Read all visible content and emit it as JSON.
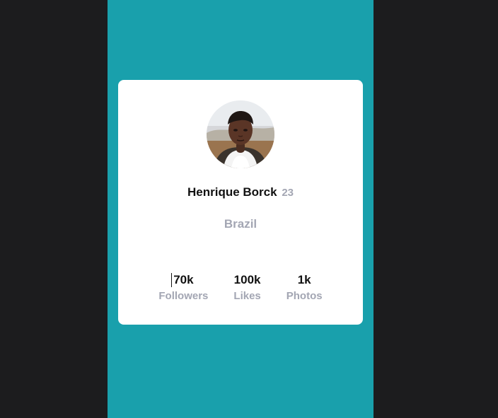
{
  "profile": {
    "name": "Henrique Borck",
    "age": "23",
    "country": "Brazil",
    "stats": [
      {
        "value": "70k",
        "label": "Followers"
      },
      {
        "value": "100k",
        "label": "Likes"
      },
      {
        "value": "1k",
        "label": "Photos"
      }
    ]
  },
  "colors": {
    "page_background": "#1c1c1e",
    "viewport_background": "#19a0ac",
    "card_background": "#ffffff",
    "primary_text": "#111111",
    "secondary_text": "#a3a6b3"
  }
}
